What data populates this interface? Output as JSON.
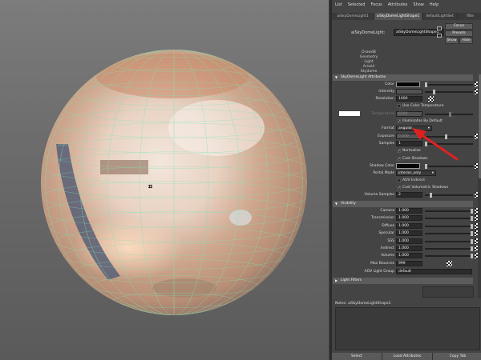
{
  "menubar": [
    "List",
    "Selected",
    "Focus",
    "Attributes",
    "Show",
    "Help"
  ],
  "tabs": [
    "aiSkyDomeLight1",
    "aiSkyDomeLightShape1",
    "defaultLightSet",
    "filte"
  ],
  "node": {
    "label": "aiSkyDomeLight:",
    "value": "aiSkyDomeLightShape1"
  },
  "buttons": {
    "focus": "Focus",
    "presets": "Presets",
    "show": "Show",
    "hide": "Hide"
  },
  "classes": [
    "DrawdB",
    "Geometry",
    "Light",
    "Arnold",
    "Skydome"
  ],
  "sections": {
    "skydome": "SkyDomeLight Attributes",
    "visibility": "Visibility",
    "light_filters": "Light Filters"
  },
  "attrs": {
    "color": "Color",
    "intensity": "Intensity",
    "resolution": "Resolution",
    "resolution_value": "1000",
    "use_color_temperature": "Use Color Temperature",
    "temperature": "Temperature",
    "temperature_value": "6500",
    "illuminates_by_default": "Illuminates By Default",
    "format": "Format",
    "format_value": "angular",
    "exposure": "Exposure",
    "exposure_value": "0.000",
    "samples": "Samples",
    "samples_value": "1",
    "normalize": "Normalize",
    "cast_shadows": "Cast Shadows",
    "shadow_color": "Shadow Color",
    "portal_mode": "Portal Mode",
    "portal_mode_value": "interior_only",
    "aov_indirect": "AOV Indirect",
    "cast_volumetric_shadows": "Cast Volumetric Shadows",
    "volume_samples": "Volume Samples",
    "volume_samples_value": "2"
  },
  "visibility": [
    {
      "label": "Camera",
      "value": "1.000"
    },
    {
      "label": "Transmission",
      "value": "1.000"
    },
    {
      "label": "Diffuse",
      "value": "1.000"
    },
    {
      "label": "Specular",
      "value": "1.000"
    },
    {
      "label": "SSS",
      "value": "1.000"
    },
    {
      "label": "Indirect",
      "value": "1.000"
    },
    {
      "label": "Volume",
      "value": "1.000"
    }
  ],
  "max_bounces": {
    "label": "Max Bounces",
    "value": "999"
  },
  "aov_light_group": {
    "label": "AOV Light Group",
    "value": "default"
  },
  "notes": {
    "label": "Notes:",
    "value": "aiSkyDomeLightShape1"
  },
  "bottom_buttons": [
    "Select",
    "Load Attributes",
    "Copy Tab"
  ],
  "colors": {
    "annotation_arrow": "#e02020",
    "panel_bg": "#444444",
    "section_header": "#5c5c5c"
  }
}
